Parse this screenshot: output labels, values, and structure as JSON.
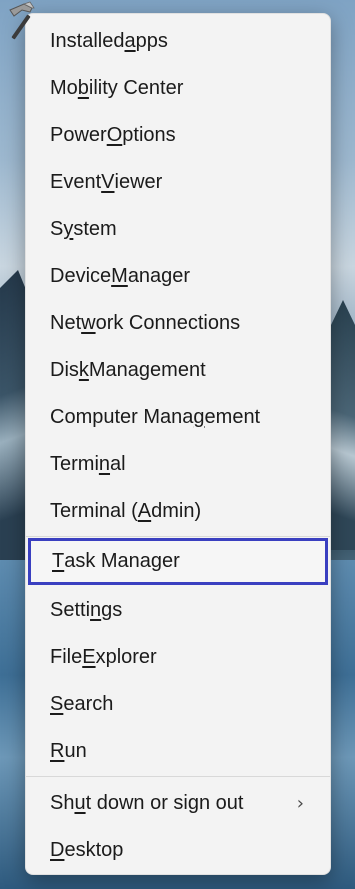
{
  "menu": {
    "items": [
      {
        "pre": "Installed ",
        "u": "a",
        "post": "pps"
      },
      {
        "pre": "Mo",
        "u": "b",
        "post": "ility Center"
      },
      {
        "pre": "Power ",
        "u": "O",
        "post": "ptions"
      },
      {
        "pre": "Event ",
        "u": "V",
        "post": "iewer"
      },
      {
        "pre": "S",
        "u": "y",
        "post": "stem"
      },
      {
        "pre": "Device ",
        "u": "M",
        "post": "anager"
      },
      {
        "pre": "Net",
        "u": "w",
        "post": "ork Connections"
      },
      {
        "pre": "Dis",
        "u": "k",
        "post": " Management"
      },
      {
        "pre": "Computer Mana",
        "u": "g",
        "post": "ement"
      },
      {
        "pre": "Termi",
        "u": "n",
        "post": "al"
      },
      {
        "pre": "Terminal (",
        "u": "A",
        "post": "dmin)"
      },
      {
        "pre": "",
        "u": "T",
        "post": "ask Manager"
      },
      {
        "pre": "Setti",
        "u": "n",
        "post": "gs"
      },
      {
        "pre": "File ",
        "u": "E",
        "post": "xplorer"
      },
      {
        "pre": "",
        "u": "S",
        "post": "earch"
      },
      {
        "pre": "",
        "u": "R",
        "post": "un"
      },
      {
        "pre": "Sh",
        "u": "u",
        "post": "t down or sign out"
      },
      {
        "pre": "",
        "u": "D",
        "post": "esktop"
      }
    ],
    "submenu_chevron": "›",
    "highlight_color": "#3a3fc0"
  },
  "icons": {
    "corner_icon": "hammer-icon"
  }
}
